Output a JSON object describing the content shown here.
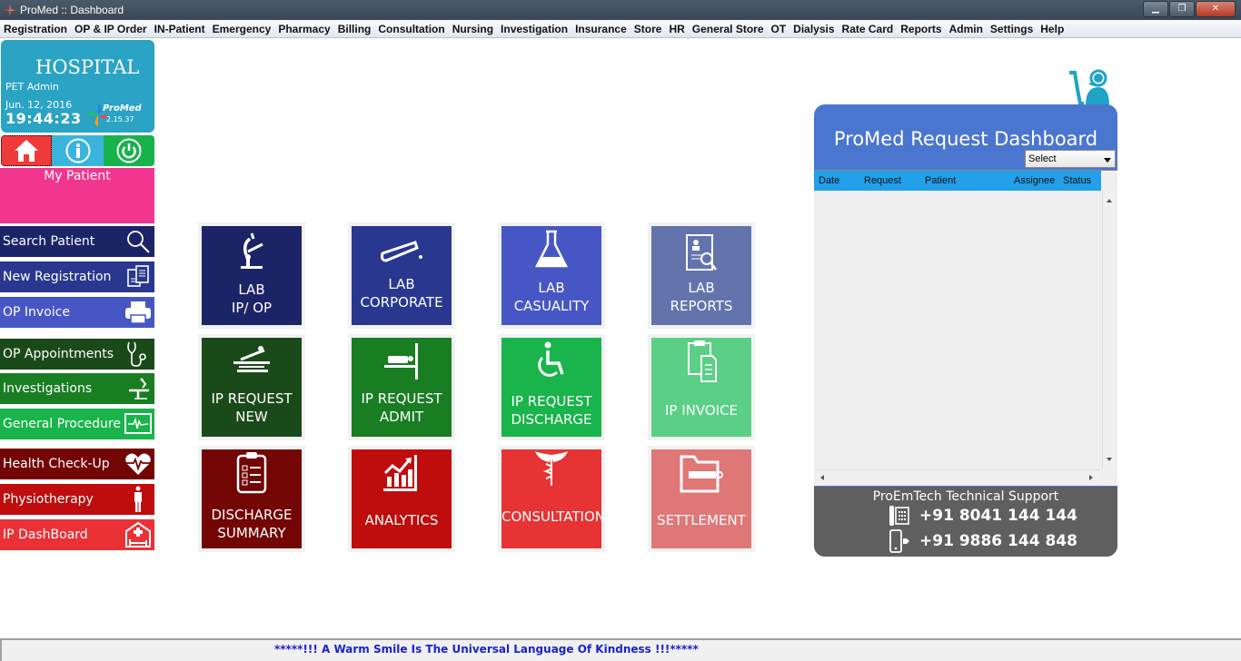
{
  "window": {
    "title": "ProMed :: Dashboard",
    "controls": [
      "minimize",
      "restore",
      "close"
    ]
  },
  "menu": [
    "Registration",
    "OP & IP Order",
    "IN-Patient",
    "Emergency",
    "Pharmacy",
    "Billing",
    "Consultation",
    "Nursing",
    "Investigation",
    "Insurance",
    "Store",
    "HR",
    "General Store",
    "OT",
    "Dialysis",
    "Rate Card",
    "Reports",
    "Admin",
    "Settings",
    "Help"
  ],
  "hospital": {
    "name": "HOSPITAL",
    "user": "PET Admin",
    "date": "Jun. 12, 2016",
    "time": "19:44:23",
    "brand": "ProMed",
    "version": "2.15.37"
  },
  "quickbar": {
    "home": "home-icon",
    "info": "info-icon",
    "power": "power-icon"
  },
  "my_patient": "My Patient",
  "sidebar": [
    {
      "label": "Search Patient",
      "icon": "search-icon",
      "color": "#1b2467"
    },
    {
      "label": "New Registration",
      "icon": "registration-form-icon",
      "color": "#29378f"
    },
    {
      "label": "OP Invoice",
      "icon": "printer-icon",
      "color": "#4656c4"
    },
    {
      "label": "OP Appointments",
      "icon": "stethoscope-icon",
      "color": "#1b4a1a"
    },
    {
      "label": "Investigations",
      "icon": "microscope-icon",
      "color": "#197d22"
    },
    {
      "label": "General Procedure",
      "icon": "ecg-monitor-icon",
      "color": "#19b44b"
    },
    {
      "label": "Health Check-Up",
      "icon": "heart-pulse-icon",
      "color": "#730505"
    },
    {
      "label": "Physiotherapy",
      "icon": "person-icon",
      "color": "#bf0c0c"
    },
    {
      "label": "IP DashBoard",
      "icon": "hospital-bed-icon",
      "color": "#ea3136"
    }
  ],
  "tiles": [
    {
      "lines": [
        "LAB",
        "IP/ OP"
      ],
      "icon": "microscope-icon",
      "color": "#1b2467"
    },
    {
      "lines": [
        "LAB",
        "CORPORATE"
      ],
      "icon": "test-tube-icon",
      "color": "#29378f"
    },
    {
      "lines": [
        "LAB",
        "CASUALITY"
      ],
      "icon": "flask-icon",
      "color": "#4656c4"
    },
    {
      "lines": [
        "LAB",
        "REPORTS"
      ],
      "icon": "report-search-icon",
      "color": "#6374ad"
    },
    {
      "lines": [
        "IP REQUEST",
        "NEW"
      ],
      "icon": "patient-bed-icon",
      "color": "#1b4a1a"
    },
    {
      "lines": [
        "IP REQUEST",
        "ADMIT"
      ],
      "icon": "bed-admit-icon",
      "color": "#197d22"
    },
    {
      "lines": [
        "IP REQUEST",
        "DISCHARGE"
      ],
      "icon": "wheelchair-icon",
      "color": "#19b44b"
    },
    {
      "lines": [
        "IP INVOICE"
      ],
      "icon": "clipboard-doc-icon",
      "color": "#5bcf85"
    },
    {
      "lines": [
        "DISCHARGE",
        "SUMMARY"
      ],
      "icon": "checklist-icon",
      "color": "#730505"
    },
    {
      "lines": [
        "ANALYTICS"
      ],
      "icon": "chart-growth-icon",
      "color": "#bf0c0c"
    },
    {
      "lines": [
        "CONSULTATION"
      ],
      "icon": "caduceus-icon",
      "color": "#e73333"
    },
    {
      "lines": [
        "SETTLEMENT"
      ],
      "icon": "folder-zip-icon",
      "color": "#e07777"
    }
  ],
  "request_dashboard": {
    "title": "ProMed Request Dashboard",
    "select_value": "Select",
    "columns": [
      "Date",
      "Request",
      "Patient",
      "Assignee",
      "Status"
    ],
    "rows": []
  },
  "support": {
    "title": "ProEmTech Technical Support",
    "landline": "+91 8041 144 144",
    "mobile": "+91 9886 144 848"
  },
  "status_message": "*****!!! A Warm Smile Is The Universal Language Of Kindness !!!*****"
}
